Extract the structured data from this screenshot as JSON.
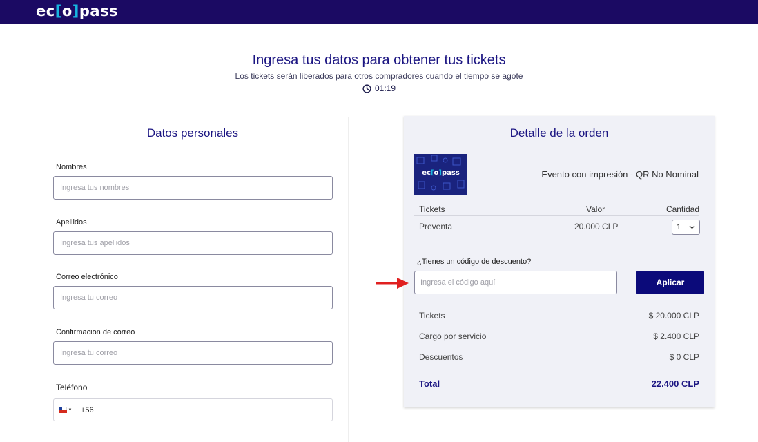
{
  "header": {
    "logo_left": "ec",
    "logo_open": "[",
    "logo_mid": "o",
    "logo_close": "]",
    "logo_right": "pass"
  },
  "intro": {
    "title": "Ingresa tus datos para obtener tus tickets",
    "subtitle": "Los tickets serán liberados para otros compradores cuando el tiempo se agote",
    "timer": "01:19"
  },
  "personal": {
    "title": "Datos personales",
    "fields": [
      {
        "label": "Nombres",
        "placeholder": "Ingresa tus nombres"
      },
      {
        "label": "Apellidos",
        "placeholder": "Ingresa tus apellidos"
      },
      {
        "label": "Correo electrónico",
        "placeholder": "Ingresa tu correo"
      },
      {
        "label": "Confirmacion de correo",
        "placeholder": "Ingresa tu correo"
      }
    ],
    "phone": {
      "label": "Teléfono",
      "code": "+56"
    }
  },
  "order": {
    "title": "Detalle de la orden",
    "event_name": "Evento con impresión - QR No Nominal",
    "table": {
      "headers": [
        "Tickets",
        "Valor",
        "Cantidad"
      ],
      "row": {
        "type": "Preventa",
        "price": "20.000 CLP",
        "quantity": "1"
      }
    },
    "discount": {
      "label": "¿Tienes un código de descuento?",
      "placeholder": "Ingresa el código aquí",
      "button": "Aplicar"
    },
    "summary": [
      {
        "label": "Tickets",
        "value": "$ 20.000 CLP"
      },
      {
        "label": "Cargo por servicio",
        "value": "$ 2.400 CLP"
      },
      {
        "label": "Descuentos",
        "value": "$ 0 CLP"
      }
    ],
    "total": {
      "label": "Total",
      "value": "22.400 CLP"
    }
  },
  "colors": {
    "header_bg": "#1b0a63",
    "accent": "#1b1582",
    "button_bg": "#0b0a7a",
    "logo_bracket": "#17b6e0",
    "annotation_arrow": "#e02020"
  }
}
